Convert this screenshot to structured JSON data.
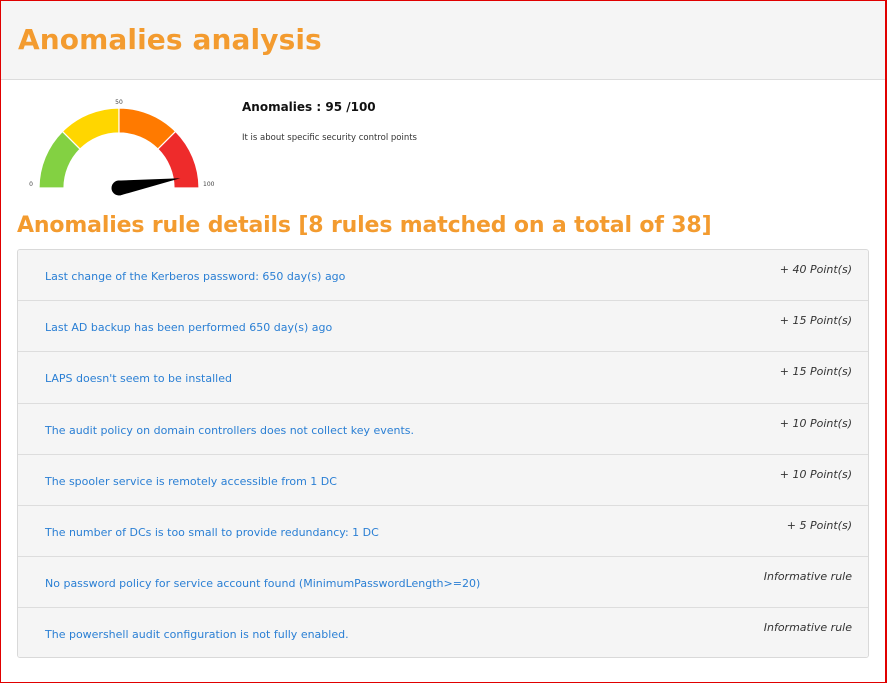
{
  "header": {
    "title": "Anomalies analysis"
  },
  "gauge": {
    "min_label": "0",
    "mid_label": "50",
    "max_label": "100",
    "value": 95,
    "max": 100,
    "segment_colors": [
      "#83d142",
      "#ffd600",
      "#ff7a00",
      "#ee2b2b"
    ],
    "needle_color": "#000000"
  },
  "score": {
    "title": "Anomalies : 95 /100",
    "description": "It is about specific security control points"
  },
  "details": {
    "title": "Anomalies rule details [8 rules matched on a total of 38]",
    "rules": [
      {
        "label": "Last change of the Kerberos password: 650 day(s) ago",
        "points": "+ 40 Point(s)"
      },
      {
        "label": "Last AD backup has been performed 650 day(s) ago",
        "points": "+ 15 Point(s)"
      },
      {
        "label": "LAPS doesn't seem to be installed",
        "points": "+ 15 Point(s)"
      },
      {
        "label": "The audit policy on domain controllers does not collect key events.",
        "points": "+ 10 Point(s)"
      },
      {
        "label": "The spooler service is remotely accessible from 1 DC",
        "points": "+ 10 Point(s)"
      },
      {
        "label": "The number of DCs is too small to provide redundancy: 1 DC",
        "points": "+ 5 Point(s)"
      },
      {
        "label": "No password policy for service account found (MinimumPasswordLength>=20)",
        "points": "Informative rule"
      },
      {
        "label": "The powershell audit configuration is not fully enabled.",
        "points": "Informative rule"
      }
    ]
  },
  "colors": {
    "accent_orange": "#f39b2f",
    "link_blue": "#2a7fd4",
    "frame_red": "#e00000"
  }
}
